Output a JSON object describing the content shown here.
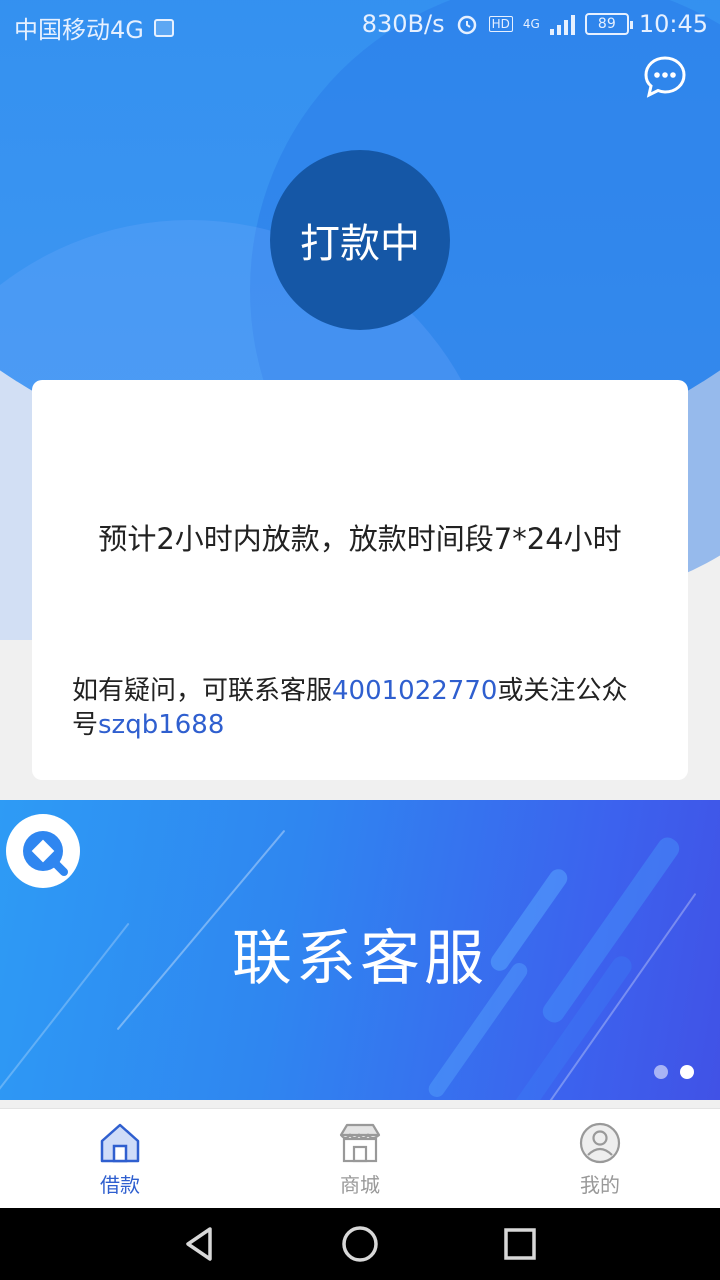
{
  "status_bar": {
    "carrier": "中国移动4G",
    "net_speed": "830B/s",
    "hd": "HD",
    "network": "4G",
    "battery": "89",
    "time": "10:45"
  },
  "loan_status": {
    "label": "打款中"
  },
  "card": {
    "main_text": "预计2小时内放款，放款时间段7*24小时",
    "note_prefix": "如有疑问，可联系客服",
    "phone": "4001022770",
    "note_middle": "或关注公众号",
    "wechat_id": "szqb1688"
  },
  "banner": {
    "title": "联系客服",
    "slides_total": 2,
    "active_slide": 2
  },
  "tabbar": {
    "items": [
      {
        "label": "借款",
        "icon": "house-icon",
        "active": true
      },
      {
        "label": "商城",
        "icon": "shop-icon",
        "active": false
      },
      {
        "label": "我的",
        "icon": "user-icon",
        "active": false
      }
    ]
  },
  "colors": {
    "primary_blue": "#3390f0",
    "status_circle": "#1557a6",
    "link": "#2f5fcf"
  }
}
